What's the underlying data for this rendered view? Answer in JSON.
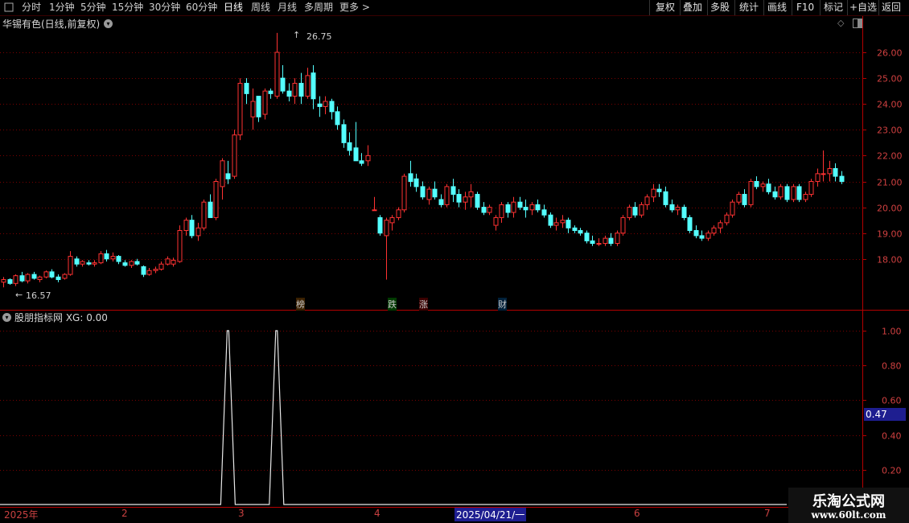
{
  "toolbar": {
    "periods": [
      "分时",
      "1分钟",
      "5分钟",
      "15分钟",
      "30分钟",
      "60分钟",
      "日线",
      "周线",
      "月线",
      "多周期",
      "更多"
    ],
    "active_period": "日线",
    "right_buttons": [
      "复权",
      "叠加",
      "多股",
      "统计",
      "画线",
      "F10",
      "标记",
      "+自选",
      "返回"
    ]
  },
  "main_chart": {
    "title": "华锡有色(日线,前复权)",
    "max_label": "26.75",
    "min_label": "16.57",
    "price_ticks": [
      "26.00",
      "25.00",
      "24.00",
      "23.00",
      "22.00",
      "21.00",
      "20.00",
      "19.00",
      "18.00"
    ],
    "markers": [
      {
        "text": "榜",
        "color": "#e8a000"
      },
      {
        "text": "跌",
        "color": "#30d030"
      },
      {
        "text": "涨",
        "color": "#ff3030"
      },
      {
        "text": "财",
        "color": "#5fa0ff"
      }
    ],
    "colors": {
      "up": "#ff3232",
      "down": "#54ffff",
      "grid": "#7a0000",
      "axis": "#b40000"
    }
  },
  "indicator": {
    "title": "股朋指标网 XG: 0.00",
    "ticks": [
      "1.00",
      "0.80",
      "0.60",
      "0.40",
      "0.20"
    ],
    "current_value": "0.47"
  },
  "date_axis": {
    "labels": [
      "2025年",
      "2",
      "3",
      "4",
      "2025/04/21/一",
      "6",
      "7"
    ]
  },
  "watermark": {
    "line1": "乐淘公式网",
    "line2": "www.60lt.com"
  },
  "chart_data": {
    "type": "candlestick",
    "symbol": "华锡有色",
    "period": "日线",
    "adjust": "前复权",
    "y_range": [
      17.0,
      26.9
    ],
    "ohlc_approx": [
      [
        17.1,
        17.3,
        16.9,
        17.2
      ],
      [
        17.2,
        17.25,
        17.0,
        17.05
      ],
      [
        17.05,
        17.4,
        16.95,
        17.35
      ],
      [
        17.35,
        17.5,
        17.1,
        17.15
      ],
      [
        17.15,
        17.45,
        17.05,
        17.4
      ],
      [
        17.4,
        17.5,
        17.2,
        17.25
      ],
      [
        17.2,
        17.35,
        17.1,
        17.3
      ],
      [
        17.3,
        17.55,
        17.25,
        17.5
      ],
      [
        17.5,
        17.6,
        17.25,
        17.3
      ],
      [
        17.3,
        17.4,
        17.1,
        17.2
      ],
      [
        17.25,
        17.45,
        17.2,
        17.4
      ],
      [
        17.4,
        18.3,
        17.35,
        18.1
      ],
      [
        18.0,
        18.1,
        17.7,
        17.8
      ],
      [
        17.8,
        17.95,
        17.7,
        17.9
      ],
      [
        17.85,
        17.95,
        17.75,
        17.8
      ],
      [
        17.8,
        17.95,
        17.7,
        17.85
      ],
      [
        17.85,
        18.3,
        17.8,
        18.2
      ],
      [
        18.2,
        18.35,
        17.9,
        18.0
      ],
      [
        18.0,
        18.25,
        17.9,
        18.1
      ],
      [
        18.1,
        18.15,
        17.8,
        17.9
      ],
      [
        17.85,
        17.95,
        17.7,
        17.75
      ],
      [
        17.75,
        17.95,
        17.65,
        17.9
      ],
      [
        17.9,
        18.0,
        17.75,
        17.8
      ],
      [
        17.7,
        17.75,
        17.3,
        17.4
      ],
      [
        17.4,
        17.65,
        17.35,
        17.55
      ],
      [
        17.55,
        17.7,
        17.45,
        17.6
      ],
      [
        17.6,
        17.9,
        17.55,
        17.8
      ],
      [
        17.8,
        18.1,
        17.75,
        18.0
      ],
      [
        17.8,
        18.05,
        17.7,
        17.95
      ],
      [
        17.9,
        19.3,
        17.85,
        19.1
      ],
      [
        19.1,
        19.6,
        18.9,
        19.5
      ],
      [
        19.5,
        19.7,
        18.8,
        18.9
      ],
      [
        18.9,
        19.4,
        18.7,
        19.2
      ],
      [
        19.2,
        20.3,
        19.1,
        20.2
      ],
      [
        20.2,
        20.5,
        19.6,
        19.6
      ],
      [
        19.6,
        21.1,
        19.5,
        21.0
      ],
      [
        20.8,
        21.9,
        20.3,
        21.8
      ],
      [
        21.3,
        21.8,
        20.9,
        21.1
      ],
      [
        21.2,
        23.0,
        21.1,
        22.8
      ],
      [
        22.8,
        25.0,
        22.6,
        24.8
      ],
      [
        24.8,
        25.0,
        24.0,
        24.4
      ],
      [
        23.5,
        24.6,
        23.0,
        24.1
      ],
      [
        24.3,
        24.3,
        23.3,
        23.5
      ],
      [
        23.6,
        24.6,
        23.4,
        24.5
      ],
      [
        24.5,
        24.6,
        24.2,
        24.4
      ],
      [
        24.3,
        26.75,
        24.2,
        26.0
      ],
      [
        25.0,
        25.5,
        24.4,
        24.5
      ],
      [
        24.5,
        24.8,
        24.1,
        24.3
      ],
      [
        24.3,
        25.0,
        24.0,
        24.8
      ],
      [
        24.8,
        25.2,
        24.0,
        24.3
      ],
      [
        24.3,
        25.4,
        24.2,
        25.1
      ],
      [
        25.2,
        25.5,
        23.8,
        24.2
      ],
      [
        24.0,
        24.3,
        23.5,
        23.9
      ],
      [
        23.9,
        24.3,
        23.6,
        24.1
      ],
      [
        24.1,
        24.2,
        23.4,
        23.7
      ],
      [
        23.7,
        23.9,
        23.0,
        23.2
      ],
      [
        23.2,
        23.4,
        22.3,
        22.5
      ],
      [
        22.5,
        22.9,
        22.0,
        22.2
      ],
      [
        22.3,
        23.3,
        21.8,
        21.8
      ],
      [
        21.8,
        22.1,
        21.6,
        21.7
      ],
      [
        21.8,
        22.4,
        21.6,
        22.0
      ],
      [
        19.9,
        20.4,
        19.9,
        19.9
      ],
      [
        19.6,
        19.7,
        18.9,
        19.0
      ],
      [
        18.9,
        19.6,
        17.2,
        19.5
      ],
      [
        19.4,
        19.7,
        19.1,
        19.6
      ],
      [
        19.6,
        20.0,
        19.5,
        19.9
      ],
      [
        19.9,
        21.3,
        19.8,
        21.2
      ],
      [
        21.3,
        21.8,
        20.8,
        21.0
      ],
      [
        21.1,
        21.3,
        20.6,
        20.8
      ],
      [
        20.8,
        21.0,
        20.3,
        20.4
      ],
      [
        20.3,
        20.8,
        20.1,
        20.7
      ],
      [
        20.7,
        21.0,
        20.3,
        20.4
      ],
      [
        20.3,
        20.5,
        20.0,
        20.1
      ],
      [
        20.1,
        20.9,
        20.0,
        20.8
      ],
      [
        20.8,
        21.1,
        20.2,
        20.5
      ],
      [
        20.5,
        20.7,
        20.0,
        20.2
      ],
      [
        20.2,
        20.6,
        19.9,
        20.4
      ],
      [
        20.4,
        20.9,
        20.0,
        20.6
      ],
      [
        20.5,
        20.6,
        19.9,
        20.0
      ],
      [
        20.0,
        20.2,
        19.7,
        19.8
      ],
      [
        19.8,
        20.1,
        19.7,
        20.0
      ],
      [
        19.3,
        19.7,
        19.1,
        19.6
      ],
      [
        19.6,
        20.2,
        19.4,
        20.1
      ],
      [
        20.1,
        20.2,
        19.6,
        19.8
      ],
      [
        19.8,
        20.4,
        19.6,
        20.2
      ],
      [
        20.2,
        20.4,
        19.9,
        20.0
      ],
      [
        20.0,
        20.3,
        19.6,
        19.9
      ],
      [
        19.9,
        20.2,
        19.7,
        20.1
      ],
      [
        20.1,
        20.3,
        19.8,
        19.9
      ],
      [
        19.9,
        20.1,
        19.6,
        19.7
      ],
      [
        19.7,
        19.8,
        19.2,
        19.3
      ],
      [
        19.3,
        19.6,
        19.1,
        19.4
      ],
      [
        19.4,
        19.7,
        19.2,
        19.5
      ],
      [
        19.5,
        19.6,
        19.0,
        19.2
      ],
      [
        19.2,
        19.3,
        19.0,
        19.1
      ],
      [
        19.1,
        19.2,
        18.9,
        19.0
      ],
      [
        19.0,
        19.1,
        18.6,
        18.7
      ],
      [
        18.7,
        18.9,
        18.5,
        18.6
      ],
      [
        18.6,
        18.8,
        18.5,
        18.6
      ],
      [
        18.6,
        18.9,
        18.5,
        18.8
      ],
      [
        18.8,
        19.0,
        18.5,
        18.6
      ],
      [
        18.6,
        19.1,
        18.5,
        19.0
      ],
      [
        19.0,
        19.7,
        18.9,
        19.6
      ],
      [
        19.6,
        20.1,
        19.5,
        20.0
      ],
      [
        20.0,
        20.2,
        19.6,
        19.7
      ],
      [
        19.7,
        20.2,
        19.6,
        20.1
      ],
      [
        20.1,
        20.5,
        19.9,
        20.4
      ],
      [
        20.4,
        20.9,
        20.2,
        20.7
      ],
      [
        20.7,
        20.9,
        20.4,
        20.6
      ],
      [
        20.6,
        20.8,
        20.0,
        20.1
      ],
      [
        20.1,
        20.3,
        19.8,
        19.9
      ],
      [
        19.9,
        20.1,
        19.7,
        20.0
      ],
      [
        20.0,
        20.1,
        19.5,
        19.6
      ],
      [
        19.6,
        19.7,
        19.0,
        19.1
      ],
      [
        19.1,
        19.3,
        18.8,
        18.9
      ],
      [
        18.9,
        19.1,
        18.7,
        18.8
      ],
      [
        18.8,
        19.1,
        18.7,
        19.0
      ],
      [
        19.0,
        19.3,
        18.9,
        19.2
      ],
      [
        19.2,
        19.5,
        19.0,
        19.4
      ],
      [
        19.4,
        19.8,
        19.3,
        19.7
      ],
      [
        19.7,
        20.3,
        19.6,
        20.2
      ],
      [
        20.2,
        20.6,
        20.1,
        20.5
      ],
      [
        20.5,
        20.7,
        20.0,
        20.1
      ],
      [
        20.1,
        21.1,
        20.0,
        21.0
      ],
      [
        21.0,
        21.2,
        20.7,
        20.8
      ],
      [
        20.8,
        21.0,
        20.6,
        20.9
      ],
      [
        20.9,
        21.1,
        20.5,
        20.6
      ],
      [
        20.6,
        20.8,
        20.3,
        20.4
      ],
      [
        20.4,
        20.9,
        20.3,
        20.8
      ],
      [
        20.8,
        20.9,
        20.2,
        20.3
      ],
      [
        20.3,
        20.9,
        20.2,
        20.8
      ],
      [
        20.8,
        20.9,
        20.2,
        20.3
      ],
      [
        20.3,
        20.6,
        20.2,
        20.5
      ],
      [
        20.5,
        21.1,
        20.4,
        21.0
      ],
      [
        21.0,
        21.5,
        20.8,
        21.3
      ],
      [
        21.3,
        22.2,
        21.0,
        21.3
      ],
      [
        21.3,
        21.8,
        21.0,
        21.5
      ],
      [
        21.5,
        21.7,
        21.0,
        21.2
      ],
      [
        21.2,
        21.4,
        20.9,
        21.0
      ]
    ],
    "indicator_series": {
      "name": "XG",
      "range": [
        0,
        1
      ],
      "signals": [
        {
          "candle_index": 37,
          "value": 1.0
        },
        {
          "candle_index": 45,
          "value": 1.0
        }
      ]
    },
    "x_labels": [
      "2025年",
      "2",
      "3",
      "4",
      "2025/04/21/一",
      "6",
      "7"
    ]
  }
}
